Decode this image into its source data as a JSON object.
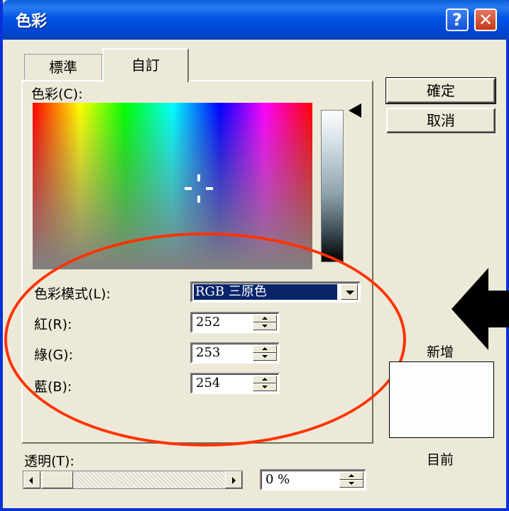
{
  "window": {
    "title": "色彩"
  },
  "tabs": [
    {
      "label": "標準",
      "active": false
    },
    {
      "label": "自訂",
      "active": true
    }
  ],
  "color_picker": {
    "label": "色彩(C):"
  },
  "buttons": {
    "ok": "確定",
    "cancel": "取消"
  },
  "color_mode": {
    "label": "色彩模式(L):",
    "value": "RGB 三原色"
  },
  "fields": [
    {
      "label": "紅(R):",
      "value": "252"
    },
    {
      "label": "綠(G):",
      "value": "253"
    },
    {
      "label": "藍(B):",
      "value": "254"
    }
  ],
  "preview": {
    "new_label": "新增",
    "current_label": "目前",
    "new_color": "#fcfdfe"
  },
  "transparency": {
    "label": "透明(T):",
    "value": "0 %",
    "fraction": 0.0
  },
  "colors": {
    "titlebar": "#0055e5",
    "dialog_bg": "#ece9d8",
    "annotation_ellipse": "#ff3300",
    "annotation_arrow": "#000000",
    "selection": "#0a246a"
  }
}
